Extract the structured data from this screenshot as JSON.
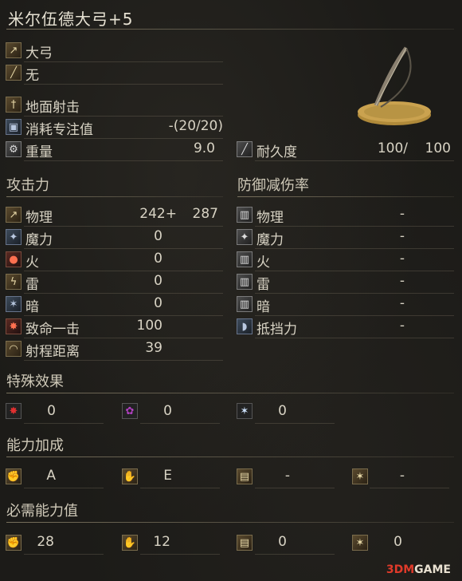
{
  "title": "米尔伍德大弓+5",
  "weapon": {
    "type_label": "大弓",
    "infusion_label": "无",
    "skill_label": "地面射击",
    "fp_label": "消耗专注值",
    "fp_value": "-(20/20)",
    "weight_label": "重量",
    "weight_value": "9.0",
    "durability_label": "耐久度",
    "durability_value": "100/",
    "durability_max": "100"
  },
  "attack": {
    "header": "攻击力",
    "rows": [
      {
        "label": "物理",
        "value": "242+",
        "extra": "287"
      },
      {
        "label": "魔力",
        "value": "0"
      },
      {
        "label": "火",
        "value": "0"
      },
      {
        "label": "雷",
        "value": "0"
      },
      {
        "label": "暗",
        "value": "0"
      },
      {
        "label": "致命一击",
        "value": "100"
      },
      {
        "label": "射程距离",
        "value": "39"
      }
    ]
  },
  "defense": {
    "header": "防御减伤率",
    "rows": [
      {
        "label": "物理",
        "value": "-"
      },
      {
        "label": "魔力",
        "value": "-"
      },
      {
        "label": "火",
        "value": "-"
      },
      {
        "label": "雷",
        "value": "-"
      },
      {
        "label": "暗",
        "value": "-"
      },
      {
        "label": "抵挡力",
        "value": "-"
      }
    ]
  },
  "effects": {
    "header": "特殊效果",
    "items": [
      {
        "icon": "bleed-icon",
        "value": "0"
      },
      {
        "icon": "poison-icon",
        "value": "0"
      },
      {
        "icon": "frost-icon",
        "value": "0"
      }
    ]
  },
  "scaling": {
    "header": "能力加成",
    "items": [
      {
        "icon": "strength-icon",
        "value": "A"
      },
      {
        "icon": "dexterity-icon",
        "value": "E"
      },
      {
        "icon": "intelligence-icon",
        "value": "-"
      },
      {
        "icon": "faith-icon",
        "value": "-"
      }
    ]
  },
  "requirements": {
    "header": "必需能力值",
    "items": [
      {
        "icon": "strength-icon",
        "value": "28"
      },
      {
        "icon": "dexterity-icon",
        "value": "12"
      },
      {
        "icon": "intelligence-icon",
        "value": "0"
      },
      {
        "icon": "faith-icon",
        "value": "0"
      }
    ]
  },
  "watermark": {
    "part1": "3DM",
    "part2": "GAME"
  }
}
